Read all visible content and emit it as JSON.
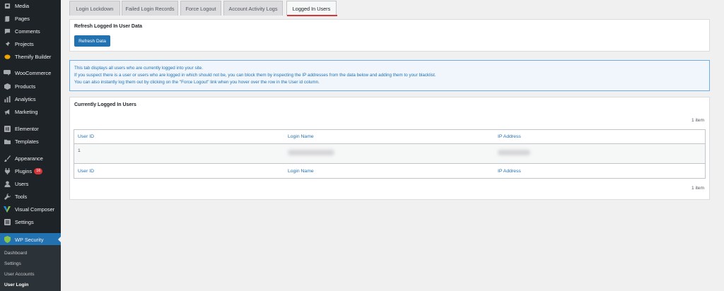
{
  "sidebar": {
    "items": [
      {
        "label": "Media",
        "icon": "media-icon"
      },
      {
        "label": "Pages",
        "icon": "pages-icon"
      },
      {
        "label": "Comments",
        "icon": "comments-icon"
      },
      {
        "label": "Projects",
        "icon": "pin-icon"
      },
      {
        "label": "Themify Builder",
        "icon": "themify-icon"
      },
      {
        "label": "WooCommerce",
        "icon": "woocommerce-icon"
      },
      {
        "label": "Products",
        "icon": "products-icon"
      },
      {
        "label": "Analytics",
        "icon": "analytics-icon"
      },
      {
        "label": "Marketing",
        "icon": "megaphone-icon"
      },
      {
        "label": "Elementor",
        "icon": "elementor-icon"
      },
      {
        "label": "Templates",
        "icon": "folder-icon"
      },
      {
        "label": "Appearance",
        "icon": "brush-icon"
      },
      {
        "label": "Plugins",
        "icon": "plugin-icon",
        "badge": "16"
      },
      {
        "label": "Users",
        "icon": "user-icon"
      },
      {
        "label": "Tools",
        "icon": "wrench-icon"
      },
      {
        "label": "Visual Composer",
        "icon": "visual-composer-icon"
      },
      {
        "label": "Settings",
        "icon": "settings-icon"
      },
      {
        "label": "WP Security",
        "icon": "shield-icon"
      }
    ],
    "submenu": [
      "Dashboard",
      "Settings",
      "User Accounts",
      "User Login"
    ]
  },
  "tabs": [
    {
      "label": "Login Lockdown"
    },
    {
      "label": "Failed Login Records"
    },
    {
      "label": "Force Logout"
    },
    {
      "label": "Account Activity Logs"
    },
    {
      "label": "Logged In Users"
    }
  ],
  "refresh_panel": {
    "title": "Refresh Logged In User Data",
    "button_label": "Refresh Data"
  },
  "info": {
    "lines": [
      "This tab displays all users who are currently logged into your site.",
      "If you suspect there is a user or users who are logged in which should not be, you can block them by inspecting the IP addresses from the data below and adding them to your blacklist.",
      "You can also instantly log them out by clicking on the \"Force Logout\" link when you hover over the row in the User id column."
    ]
  },
  "users_panel": {
    "title": "Currently Logged In Users",
    "count_top": "1 item",
    "count_bottom": "1 item",
    "columns": [
      "User ID",
      "Login Name",
      "IP Address"
    ],
    "rows": [
      {
        "user_id": "1"
      }
    ]
  },
  "colors": {
    "sidebar_bg": "#1d2327",
    "accent": "#2271b1",
    "active_tab_underline": "#d63638",
    "badge": "#d63638"
  }
}
